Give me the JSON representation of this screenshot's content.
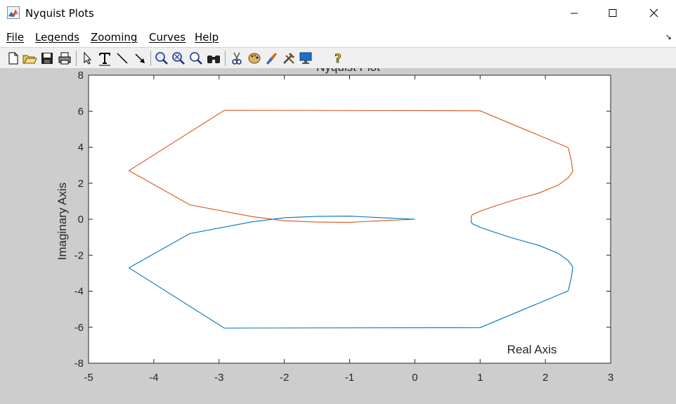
{
  "window": {
    "title": "Nyquist Plots",
    "icon": "matlab-figure-icon",
    "controls": [
      "minimize",
      "maximize",
      "close"
    ]
  },
  "menu": {
    "items": [
      {
        "label": "File"
      },
      {
        "label": "Legends"
      },
      {
        "label": "Zooming"
      },
      {
        "label": "Curves"
      },
      {
        "label": "Help"
      }
    ]
  },
  "toolbar": {
    "buttons": [
      "new-file-icon",
      "open-folder-icon",
      "save-icon",
      "print-icon",
      "select-arrow-icon",
      "insert-text-icon",
      "insert-line-icon",
      "insert-arrow-icon",
      "zoom-in-icon",
      "zoom-out-icon",
      "zoom-reset-icon",
      "binoculars-icon",
      "scissors-icon",
      "palette-icon",
      "brush-icon",
      "tools-icon",
      "monitor-icon",
      "help-icon"
    ]
  },
  "chart_data": {
    "type": "line",
    "title": "Nyquist Plot",
    "xlabel": "Real Axis",
    "ylabel": "Imaginary Axis",
    "xlim": [
      -5,
      3
    ],
    "ylim": [
      -8,
      8
    ],
    "xticks": [
      -5,
      -4,
      -3,
      -2,
      -1,
      0,
      1,
      2,
      3
    ],
    "yticks": [
      -8,
      -6,
      -4,
      -2,
      0,
      2,
      4,
      6,
      8
    ],
    "grid": false,
    "series": [
      {
        "color": "#d95319",
        "points": [
          [
            0,
            0
          ],
          [
            -0.5,
            -0.08
          ],
          [
            -1,
            -0.17
          ],
          [
            -1.5,
            -0.16
          ],
          [
            -2,
            -0.08
          ],
          [
            -2.5,
            0.15
          ],
          [
            -3.45,
            0.8
          ],
          [
            -4.38,
            2.7
          ],
          [
            -2.92,
            6.05
          ],
          [
            1,
            6.02
          ],
          [
            2.35,
            3.98
          ],
          [
            2.4,
            3.2
          ],
          [
            2.42,
            2.65
          ],
          [
            2.35,
            2.3
          ],
          [
            2.2,
            1.9
          ],
          [
            1.9,
            1.45
          ],
          [
            1.5,
            1.05
          ],
          [
            1.2,
            0.7
          ],
          [
            1,
            0.45
          ],
          [
            0.88,
            0.25
          ],
          [
            0.86,
            0.12
          ],
          [
            0.87,
            0
          ]
        ]
      },
      {
        "color": "#0072bd",
        "points": [
          [
            0,
            0
          ],
          [
            -0.5,
            0.08
          ],
          [
            -1,
            0.17
          ],
          [
            -1.5,
            0.16
          ],
          [
            -2,
            0.08
          ],
          [
            -2.5,
            -0.15
          ],
          [
            -3.45,
            -0.8
          ],
          [
            -4.38,
            -2.7
          ],
          [
            -2.92,
            -6.05
          ],
          [
            1,
            -6.02
          ],
          [
            2.35,
            -3.98
          ],
          [
            2.4,
            -3.2
          ],
          [
            2.42,
            -2.65
          ],
          [
            2.35,
            -2.3
          ],
          [
            2.2,
            -1.9
          ],
          [
            1.9,
            -1.45
          ],
          [
            1.5,
            -1.05
          ],
          [
            1.2,
            -0.7
          ],
          [
            1,
            -0.45
          ],
          [
            0.88,
            -0.25
          ],
          [
            0.86,
            -0.12
          ],
          [
            0.87,
            0
          ]
        ]
      }
    ]
  }
}
